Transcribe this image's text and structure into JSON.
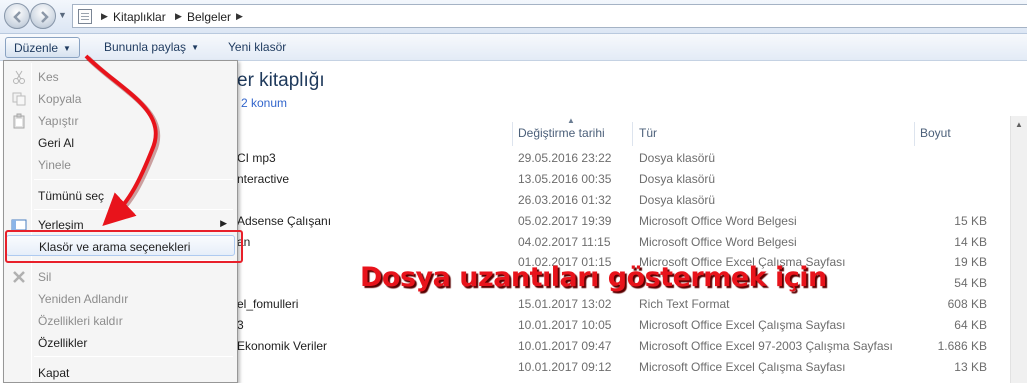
{
  "breadcrumb": [
    "Kitaplıklar",
    "Belgeler"
  ],
  "toolbar": {
    "organize": "Düzenle",
    "share": "Bununla paylaş",
    "new_folder": "Yeni klasör"
  },
  "library": {
    "title": "er kitaplığı",
    "count": "2 konum"
  },
  "columns": {
    "date": "Değiştirme tarihi",
    "type": "Tür",
    "size": "Boyut"
  },
  "rows": [
    {
      "name": "CI mp3",
      "date": "29.05.2016 23:22",
      "type": "Dosya klasörü",
      "size": ""
    },
    {
      "name": "nteractive",
      "date": "13.05.2016 00:35",
      "type": "Dosya klasörü",
      "size": ""
    },
    {
      "name": "",
      "date": "26.03.2016 01:32",
      "type": "Dosya klasörü",
      "size": ""
    },
    {
      "name": "Adsense Çalışanı",
      "date": "05.02.2017 19:39",
      "type": "Microsoft Office Word Belgesi",
      "size": "15 KB"
    },
    {
      "name": "an",
      "date": "04.02.2017 11:15",
      "type": "Microsoft Office Word Belgesi",
      "size": "14 KB"
    },
    {
      "name": "",
      "date": "01.02.2017 01:15",
      "type": "Microsoft Office Excel Çalışma Sayfası",
      "size": "19 KB"
    },
    {
      "name": "",
      "date": "",
      "type": "",
      "size": "54 KB"
    },
    {
      "name": "el_fomulleri",
      "date": "15.01.2017 13:02",
      "type": "Rich Text Format",
      "size": "608 KB"
    },
    {
      "name": "3",
      "date": "10.01.2017 10:05",
      "type": "Microsoft Office Excel Çalışma Sayfası",
      "size": "64 KB"
    },
    {
      "name": "Ekonomik Veriler",
      "date": "10.01.2017 09:47",
      "type": "Microsoft Office Excel 97-2003 Çalışma Sayfası",
      "size": "1.686 KB"
    },
    {
      "name": "",
      "date": "10.01.2017 09:12",
      "type": "Microsoft Office Excel Çalışma Sayfası",
      "size": "13 KB"
    }
  ],
  "menu": {
    "cut": "Kes",
    "copy": "Kopyala",
    "paste": "Yapıştır",
    "undo": "Geri Al",
    "redo": "Yinele",
    "select_all": "Tümünü seç",
    "layout": "Yerleşim",
    "folder_options": "Klasör ve arama seçenekleri",
    "delete": "Sil",
    "rename": "Yeniden Adlandır",
    "remove_props": "Özellikleri kaldır",
    "properties": "Özellikler",
    "close": "Kapat"
  },
  "annotation": "Dosya uzantıları göstermek için",
  "colors": {
    "annotation_red": "#e8131b",
    "highlight_box": "#e8202a",
    "library_title": "#1e395b"
  }
}
